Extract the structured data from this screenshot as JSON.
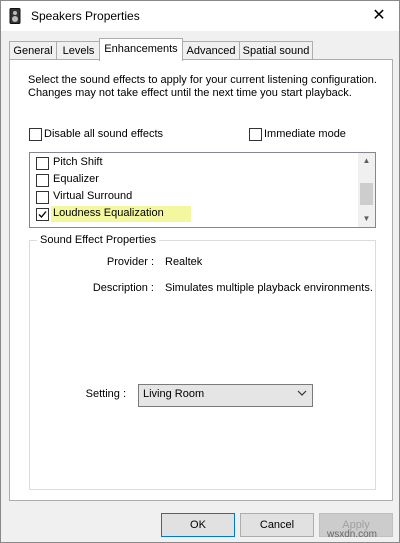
{
  "window": {
    "title": "Speakers Properties",
    "close_glyph": "✕"
  },
  "tabs": [
    {
      "label": "General"
    },
    {
      "label": "Levels"
    },
    {
      "label": "Enhancements",
      "active": true
    },
    {
      "label": "Advanced"
    },
    {
      "label": "Spatial sound"
    }
  ],
  "enhancements": {
    "description": "Select the sound effects to apply for your current listening configuration. Changes may not take effect until the next time you start playback.",
    "disable_all_label": "Disable all sound effects",
    "disable_all_checked": false,
    "immediate_mode_label": "Immediate mode",
    "immediate_mode_checked": false,
    "effects": [
      {
        "label": "Pitch Shift",
        "checked": false
      },
      {
        "label": "Equalizer",
        "checked": false
      },
      {
        "label": "Virtual Surround",
        "checked": false
      },
      {
        "label": "Loudness Equalization",
        "checked": true,
        "selected": true
      }
    ]
  },
  "properties": {
    "group_title": "Sound Effect Properties",
    "provider_label": "Provider :",
    "provider_value": "Realtek",
    "description_label": "Description :",
    "description_value": "Simulates multiple playback environments.",
    "setting_label": "Setting :",
    "setting_value": "Living Room"
  },
  "buttons": {
    "ok": "OK",
    "cancel": "Cancel",
    "apply": "Apply"
  },
  "watermark": "wsxdn.com",
  "colors": {
    "highlight": "#f3f7a0",
    "focus_border": "#0078d7"
  }
}
